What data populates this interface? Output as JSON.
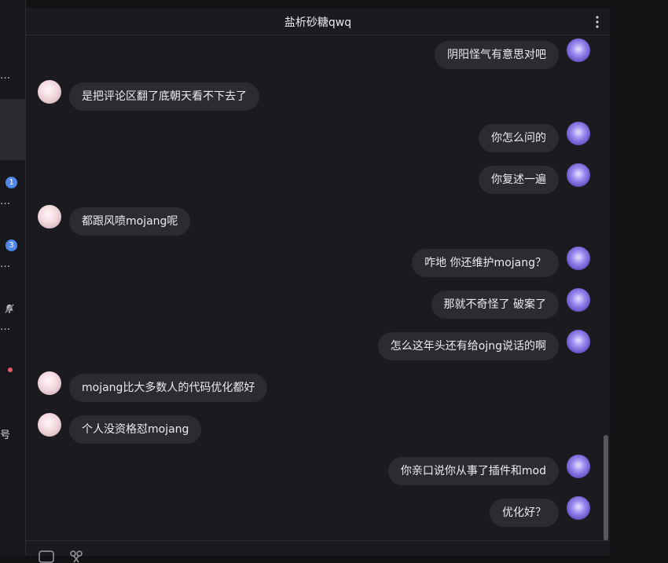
{
  "sidebar": {
    "items": [
      {
        "snippet": "…",
        "badge": ""
      },
      {
        "snippet": "",
        "badge": ""
      },
      {
        "snippet": "…",
        "badge": "1"
      },
      {
        "snippet": "…",
        "badge": "3"
      },
      {
        "snippet": "…",
        "badge": ""
      },
      {
        "snippet": "",
        "badge": ""
      },
      {
        "snippet": "号",
        "badge": ""
      }
    ]
  },
  "chat": {
    "title": "盐析砂糖qwq",
    "messages": [
      {
        "side": "right",
        "text": "阴阳怪气有意思对吧"
      },
      {
        "side": "left",
        "text": "是把评论区翻了底朝天看不下去了"
      },
      {
        "side": "right",
        "text": "你怎么问的"
      },
      {
        "side": "right",
        "text": "你复述一遍"
      },
      {
        "side": "left",
        "text": "都跟风喷mojang呢"
      },
      {
        "side": "right",
        "text": "咋地 你还维护mojang？"
      },
      {
        "side": "right",
        "text": "那就不奇怪了 破案了"
      },
      {
        "side": "right",
        "text": "怎么这年头还有给ojng说话的啊"
      },
      {
        "side": "left",
        "text": "mojang比大多数人的代码优化都好"
      },
      {
        "side": "left",
        "text": "个人没资格怼mojang"
      },
      {
        "side": "right",
        "text": "你亲口说你从事了插件和mod"
      },
      {
        "side": "right",
        "text": "优化好？"
      }
    ]
  },
  "icons": {
    "more": "more-vertical-icon",
    "emoji": "emoji-icon",
    "scissors": "scissors-icon",
    "mute": "bell-off-icon"
  },
  "colors": {
    "background": "#1b1b1f",
    "bubble": "#2b2b31",
    "badge": "#4f87ea",
    "dot": "#e75b6a"
  }
}
